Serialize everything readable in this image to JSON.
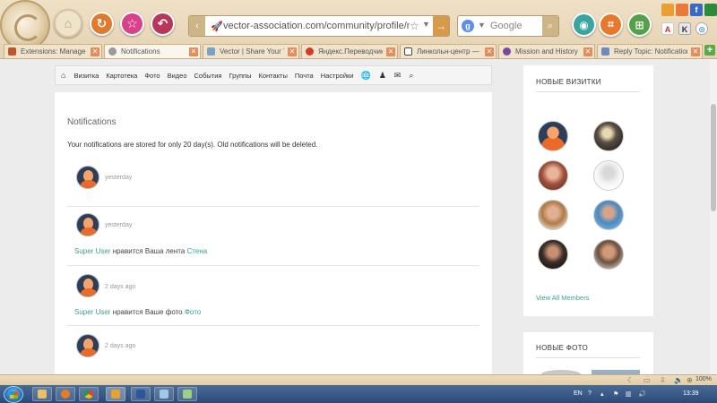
{
  "browser": {
    "url": "vector-association.com/community/profile/notifications",
    "search_engine": "Google",
    "tabs": [
      {
        "label": "Extensions: Manage - Ve",
        "color": "#c0552b"
      },
      {
        "label": "Notifications",
        "color": "#9a9a9a",
        "active": true
      },
      {
        "label": "Vector | Share Your Tale",
        "color": "#7aa3c8"
      },
      {
        "label": "Яндекс.Переводчик – с",
        "color": "#d23a2a"
      },
      {
        "label": "Линкольн-центр — Ви",
        "color": "#444444"
      },
      {
        "label": "Mission and History",
        "color": "#7a4a9a"
      },
      {
        "label": "Reply Topic: Notification",
        "color": "#6a8ac0"
      }
    ]
  },
  "nav": {
    "items": [
      "Визитка",
      "Картотека",
      "Фото",
      "Видео",
      "События",
      "Группы",
      "Контакты",
      "Почта",
      "Настройки"
    ]
  },
  "main": {
    "title": "Notifications",
    "info": "Your notifications are stored for only 20 day(s). Old notifications will be deleted.",
    "notifications": [
      {
        "time": "yesterday"
      },
      {
        "time": "yesterday",
        "user": "Super User",
        "text": " нравится Ваша лента ",
        "target": "Стена"
      },
      {
        "time": "2 days ago",
        "user": "Super User",
        "text": " нравится Ваше фото ",
        "target": "Фото"
      },
      {
        "time": "2 days ago"
      }
    ]
  },
  "sidebar": {
    "members_title": "НОВЫЕ ВИЗИТКИ",
    "view_all": "View All Members",
    "photos_title": "НОВЫЕ ФОТО"
  },
  "status": {
    "zoom": "100%"
  },
  "tray": {
    "lang": "EN",
    "clock": "13:39"
  }
}
